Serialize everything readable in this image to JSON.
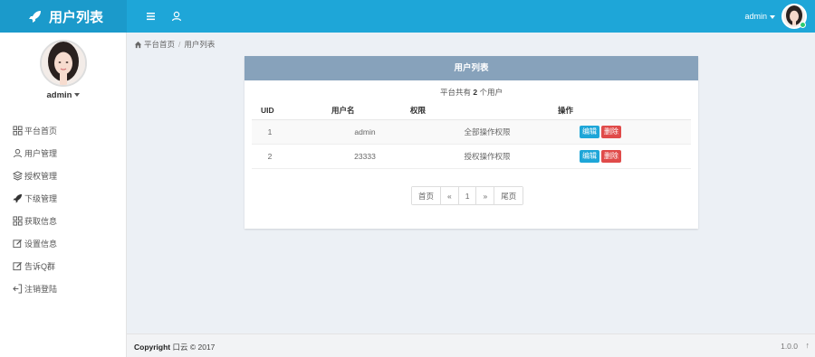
{
  "app": {
    "title": "用户列表"
  },
  "topbar": {
    "user_name": "admin"
  },
  "sidebar": {
    "user_name": "admin",
    "items": [
      {
        "label": "平台首页",
        "icon": "grid-icon"
      },
      {
        "label": "用户管理",
        "icon": "user-icon"
      },
      {
        "label": "授权管理",
        "icon": "layers-icon"
      },
      {
        "label": "下级管理",
        "icon": "rocket-icon"
      },
      {
        "label": "获取信息",
        "icon": "grid-icon"
      },
      {
        "label": "设置信息",
        "icon": "edit-icon"
      },
      {
        "label": "告诉Q群",
        "icon": "edit-icon"
      },
      {
        "label": "注销登陆",
        "icon": "logout-icon"
      }
    ]
  },
  "breadcrumb": {
    "home": "平台首页",
    "current": "用户列表"
  },
  "panel": {
    "title": "用户列表",
    "summary_prefix": "平台共有",
    "summary_count": "2",
    "summary_suffix": "个用户",
    "columns": [
      "UID",
      "用户名",
      "权限",
      "操作"
    ],
    "rows": [
      {
        "uid": "1",
        "name": "admin",
        "perm": "全部操作权限"
      },
      {
        "uid": "2",
        "name": "23333",
        "perm": "授权操作权限"
      }
    ],
    "edit_label": "编辑",
    "delete_label": "删除",
    "pager": [
      "首页",
      "«",
      "1",
      "»",
      "尾页"
    ]
  },
  "footer": {
    "copyright_label": "Copyright",
    "copyright_rest": "口云 © 2017",
    "version": "1.0.0",
    "up_glyph": "↑"
  },
  "colors": {
    "topbar": "#1ea6d8",
    "brand": "#1b9acb",
    "panel_head": "#87a2bb",
    "edit": "#1ea6d8",
    "delete": "#e04b4a"
  }
}
